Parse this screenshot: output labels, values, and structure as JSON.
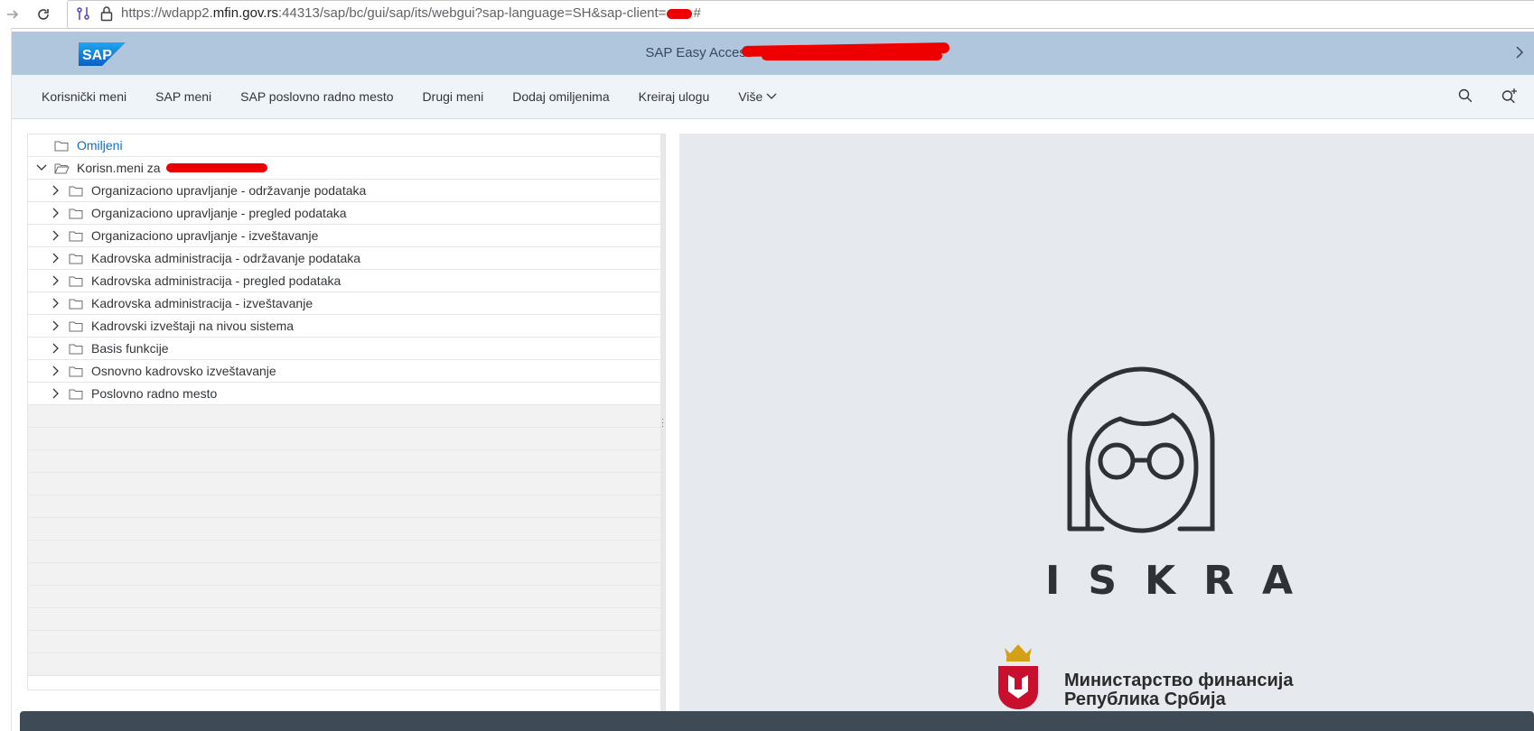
{
  "browser": {
    "url_prefix": "https://wdapp2.",
    "url_domain": "mfin.gov.rs",
    "url_suffix": ":44313/sap/bc/gui/sap/its/webgui?sap-language=SH&sap-client=",
    "url_end": "#"
  },
  "shell": {
    "logo_text": "SAP",
    "title": "SAP Easy Access  -  K"
  },
  "toolbar": {
    "items": [
      {
        "label": "Korisnički meni"
      },
      {
        "label": "SAP meni"
      },
      {
        "label": "SAP poslovno radno mesto"
      },
      {
        "label": "Drugi meni"
      },
      {
        "label": "Dodaj omiljenima"
      },
      {
        "label": "Kreiraj ulogu"
      },
      {
        "label": "Više"
      }
    ]
  },
  "tree": {
    "favorites": "Omiljeni",
    "user_menu": "Korisn.meni za",
    "items": [
      {
        "label": "Organizaciono upravljanje - održavanje podataka"
      },
      {
        "label": "Organizaciono upravljanje - pregled podataka"
      },
      {
        "label": "Organizaciono upravljanje - izveštavanje"
      },
      {
        "label": "Kadrovska administracija - održavanje podataka"
      },
      {
        "label": "Kadrovska administracija - pregled podataka"
      },
      {
        "label": "Kadrovska administracija - izveštavanje"
      },
      {
        "label": "Kadrovski izveštaji na nivou sistema"
      },
      {
        "label": "Basis funkcije"
      },
      {
        "label": "Osnovno kadrovsko izveštavanje"
      },
      {
        "label": "Poslovno radno mesto"
      }
    ]
  },
  "branding": {
    "iskra": "ISKRA",
    "ministry_line1": "Министарство финансија",
    "ministry_line2": "Република Србија"
  },
  "colors": {
    "shell": "#b0c6dd",
    "toolbar": "#eff4f9",
    "link": "#0a6ed1",
    "redaction": "#ee0000"
  }
}
